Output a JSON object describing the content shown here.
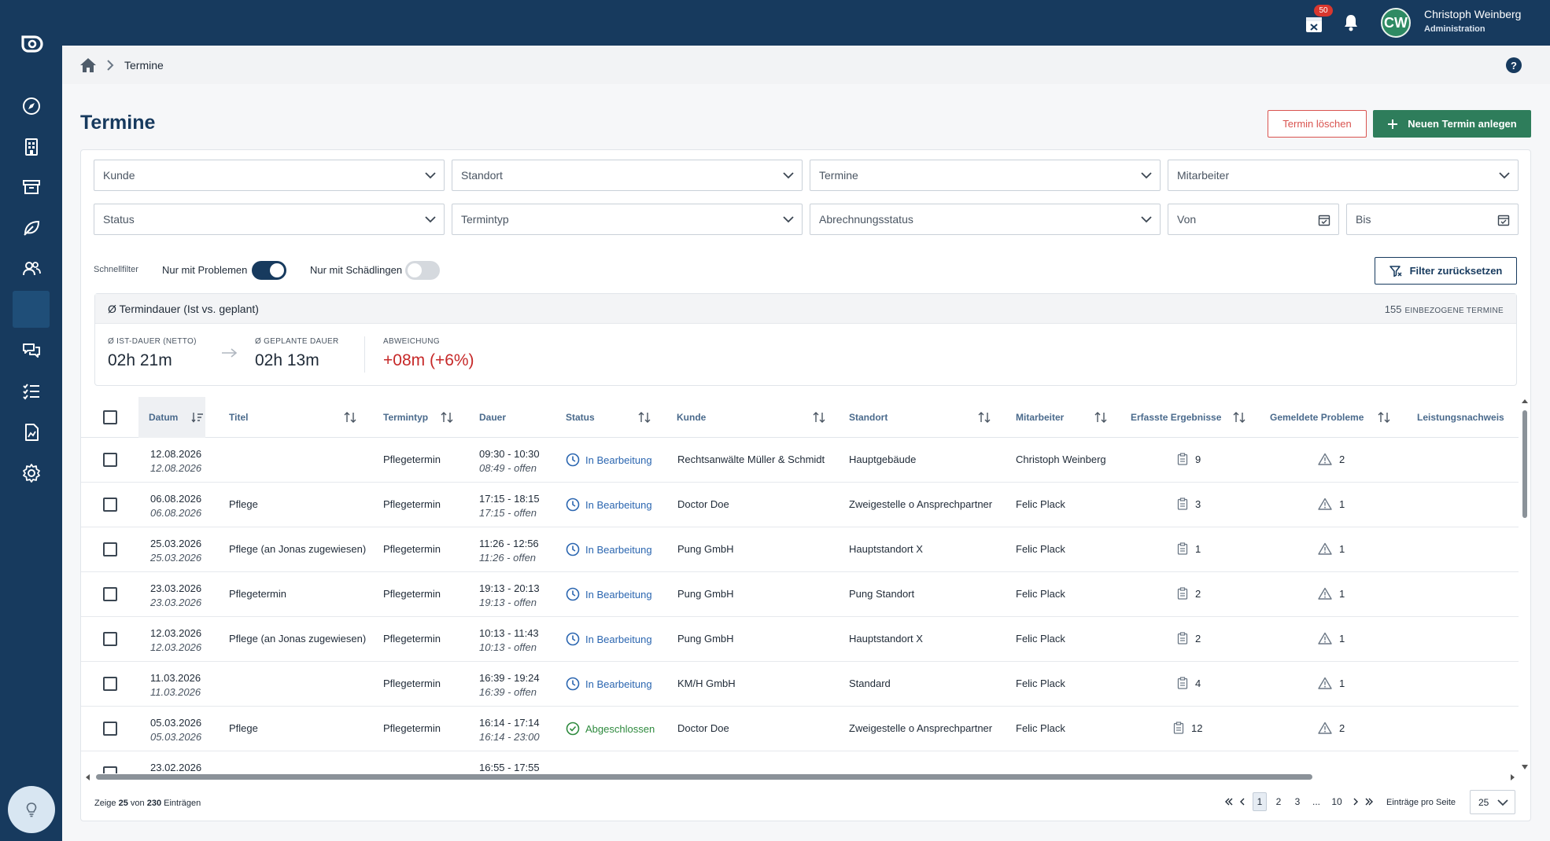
{
  "app": {
    "user_name": "Christoph Weinberg",
    "user_role": "Administration",
    "user_initials": "CW",
    "calendar_badge": "50"
  },
  "breadcrumb": {
    "current": "Termine"
  },
  "page": {
    "title": "Termine",
    "delete_label": "Termin löschen",
    "new_label": "Neuen Termin anlegen"
  },
  "filters": {
    "kunde": "Kunde",
    "standort": "Standort",
    "termine": "Termine",
    "mitarbeiter": "Mitarbeiter",
    "status": "Status",
    "termintyp": "Termintyp",
    "abrechnungsstatus": "Abrechnungsstatus",
    "von": "Von",
    "bis": "Bis"
  },
  "quickfilter": {
    "label": "Schnellfilter",
    "problems_label": "Nur mit Problemen",
    "problems_on": true,
    "pests_label": "Nur mit Schädlingen",
    "pests_on": false,
    "reset_label": "Filter zurücksetzen"
  },
  "stats": {
    "title": "Ø Termindauer (Ist vs. geplant)",
    "count": "155",
    "count_label": "EINBEZOGENE TERMINE",
    "ist_label": "Ø IST-DAUER (NETTO)",
    "ist_value": "02h 21m",
    "plan_label": "Ø GEPLANTE DAUER",
    "plan_value": "02h 13m",
    "dev_label": "ABWEICHUNG",
    "dev_value": "+08m (+6%)"
  },
  "table": {
    "headers": {
      "datum": "Datum",
      "titel": "Titel",
      "termintyp": "Termintyp",
      "dauer": "Dauer",
      "status": "Status",
      "kunde": "Kunde",
      "standort": "Standort",
      "mitarbeiter": "Mitarbeiter",
      "ergebnisse": "Erfasste Ergebnisse",
      "probleme": "Gemeldete Probleme",
      "leistung": "Leistungsnachweis"
    },
    "rows": [
      {
        "datum": "12.08.2026",
        "datum_sub": "12.08.2026",
        "titel": "",
        "typ": "Pflegetermin",
        "dauer": "09:30 - 10:30",
        "dauer_sub": "08:49 - offen",
        "status": "In Bearbeitung",
        "status_kind": "progress",
        "kunde": "Rechtsanwälte Müller & Schmidt",
        "standort": "Hauptgebäude",
        "mitarbeiter": "Christoph Weinberg",
        "ergebnisse": "9",
        "probleme": "2"
      },
      {
        "datum": "06.08.2026",
        "datum_sub": "06.08.2026",
        "titel": "Pflege",
        "typ": "Pflegetermin",
        "dauer": "17:15 - 18:15",
        "dauer_sub": "17:15 - offen",
        "status": "In Bearbeitung",
        "status_kind": "progress",
        "kunde": "Doctor Doe",
        "standort": "Zweigestelle o Ansprechpartner",
        "mitarbeiter": "Felic Plack",
        "ergebnisse": "3",
        "probleme": "1"
      },
      {
        "datum": "25.03.2026",
        "datum_sub": "25.03.2026",
        "titel": "Pflege (an Jonas zugewiesen)",
        "typ": "Pflegetermin",
        "dauer": "11:26 - 12:56",
        "dauer_sub": "11:26 - offen",
        "status": "In Bearbeitung",
        "status_kind": "progress",
        "kunde": "Pung GmbH",
        "standort": "Hauptstandort X",
        "mitarbeiter": "Felic Plack",
        "ergebnisse": "1",
        "probleme": "1"
      },
      {
        "datum": "23.03.2026",
        "datum_sub": "23.03.2026",
        "titel": "Pflegetermin",
        "typ": "Pflegetermin",
        "dauer": "19:13 - 20:13",
        "dauer_sub": "19:13 - offen",
        "status": "In Bearbeitung",
        "status_kind": "progress",
        "kunde": "Pung GmbH",
        "standort": "Pung Standort",
        "mitarbeiter": "Felic Plack",
        "ergebnisse": "2",
        "probleme": "1"
      },
      {
        "datum": "12.03.2026",
        "datum_sub": "12.03.2026",
        "titel": "Pflege (an Jonas zugewiesen)",
        "typ": "Pflegetermin",
        "dauer": "10:13 - 11:43",
        "dauer_sub": "10:13 - offen",
        "status": "In Bearbeitung",
        "status_kind": "progress",
        "kunde": "Pung GmbH",
        "standort": "Hauptstandort X",
        "mitarbeiter": "Felic Plack",
        "ergebnisse": "2",
        "probleme": "1"
      },
      {
        "datum": "11.03.2026",
        "datum_sub": "11.03.2026",
        "titel": "",
        "typ": "Pflegetermin",
        "dauer": "16:39 - 19:24",
        "dauer_sub": "16:39 - offen",
        "status": "In Bearbeitung",
        "status_kind": "progress",
        "kunde": "KM/H GmbH",
        "standort": "Standard",
        "mitarbeiter": "Felic Plack",
        "ergebnisse": "4",
        "probleme": "1"
      },
      {
        "datum": "05.03.2026",
        "datum_sub": "05.03.2026",
        "titel": "Pflege",
        "typ": "Pflegetermin",
        "dauer": "16:14 - 17:14",
        "dauer_sub": "16:14 - 23:00",
        "status": "Abgeschlossen",
        "status_kind": "done",
        "kunde": "Doctor Doe",
        "standort": "Zweigestelle o Ansprechpartner",
        "mitarbeiter": "Felic Plack",
        "ergebnisse": "12",
        "probleme": "2"
      },
      {
        "datum": "23.02.2026",
        "datum_sub": "",
        "titel": "",
        "typ": "",
        "dauer": "16:55 - 17:55",
        "dauer_sub": "",
        "status": "",
        "status_kind": "done",
        "kunde": "",
        "standort": "",
        "mitarbeiter": "",
        "ergebnisse": "",
        "probleme": ""
      }
    ]
  },
  "footer": {
    "prefix": "Zeige",
    "shown": "25",
    "middle": "von",
    "total": "230",
    "suffix": "Einträgen",
    "pages": [
      "1",
      "2",
      "3",
      "...",
      "10"
    ],
    "current_page": "1",
    "per_page_label": "Einträge pro Seite",
    "per_page": "25"
  },
  "colors": {
    "navy": "#173a5e",
    "green": "#2e7d5b",
    "red": "#c62828",
    "status_progress": "#2b66b0",
    "status_done": "#2e8a3e"
  }
}
